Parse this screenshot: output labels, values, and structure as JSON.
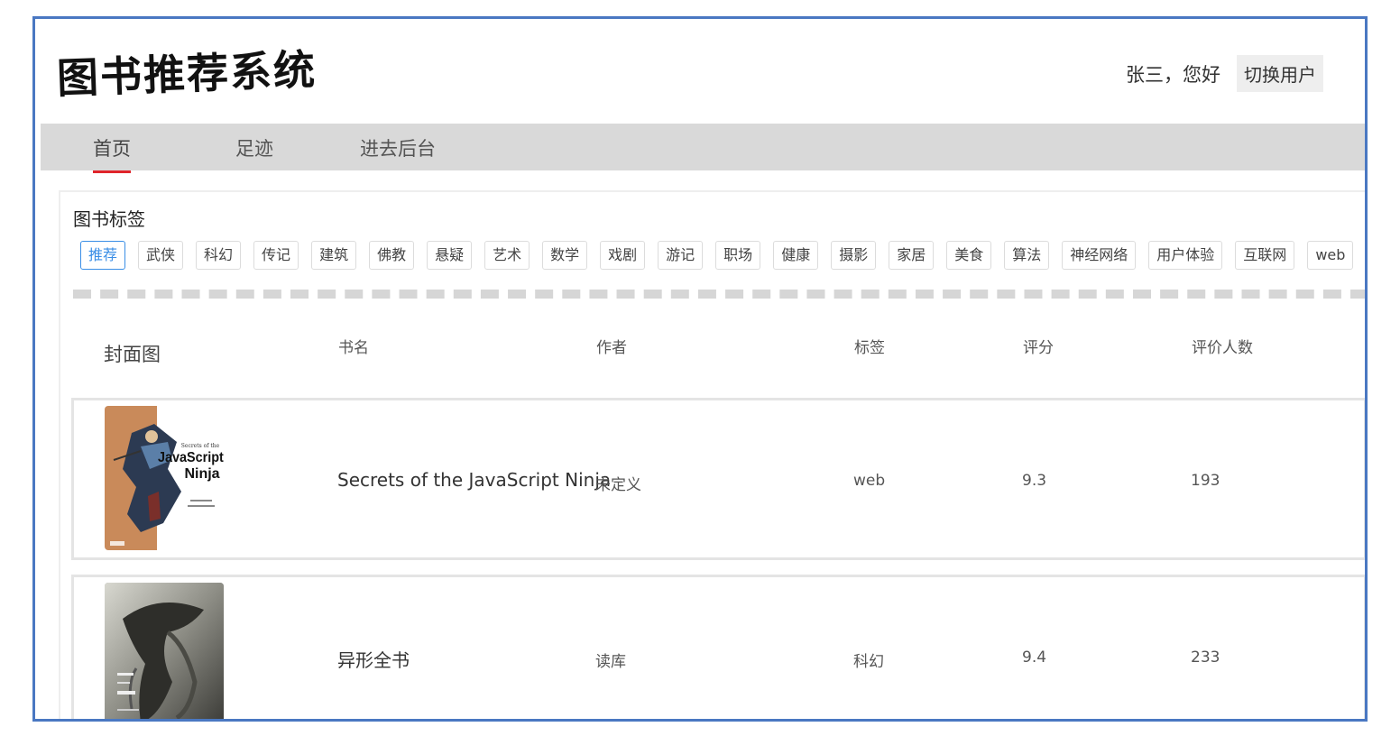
{
  "header": {
    "logo": "图书推荐系统",
    "greeting": "张三，您好",
    "switch_user": "切换用户"
  },
  "nav": {
    "items": [
      {
        "label": "首页",
        "active": true
      },
      {
        "label": "足迹",
        "active": false
      },
      {
        "label": "进去后台",
        "active": false
      }
    ]
  },
  "tags_section": {
    "title": "图书标签",
    "tags": [
      {
        "label": "推荐",
        "active": true
      },
      {
        "label": "武侠"
      },
      {
        "label": "科幻"
      },
      {
        "label": "传记"
      },
      {
        "label": "建筑"
      },
      {
        "label": "佛教"
      },
      {
        "label": "悬疑"
      },
      {
        "label": "艺术"
      },
      {
        "label": "数学"
      },
      {
        "label": "戏剧"
      },
      {
        "label": "游记"
      },
      {
        "label": "职场"
      },
      {
        "label": "健康"
      },
      {
        "label": "摄影"
      },
      {
        "label": "家居"
      },
      {
        "label": "美食"
      },
      {
        "label": "算法"
      },
      {
        "label": "神经网络"
      },
      {
        "label": "用户体验"
      },
      {
        "label": "互联网"
      },
      {
        "label": "web"
      }
    ]
  },
  "table": {
    "headers": {
      "cover": "封面图",
      "title": "书名",
      "author": "作者",
      "tag": "标签",
      "rating": "评分",
      "count": "评价人数"
    },
    "rows": [
      {
        "cover_icon": "javascript-ninja-cover",
        "cover_text_small": "Secrets of the",
        "cover_text_big1": "JavaScript",
        "cover_text_big2": "Ninja",
        "title": "Secrets of the JavaScript Ninja",
        "author": "未定义",
        "tag": "web",
        "rating": "9.3",
        "count": "193"
      },
      {
        "cover_icon": "alien-book-cover",
        "title": "异形全书",
        "author": "读库",
        "tag": "科幻",
        "rating": "9.4",
        "count": "233"
      }
    ]
  },
  "colors": {
    "frame_border": "#4a78c2",
    "nav_active_underline": "#e0242b",
    "tag_active": "#3a8ee6",
    "nav_background": "#d9d9d9"
  }
}
